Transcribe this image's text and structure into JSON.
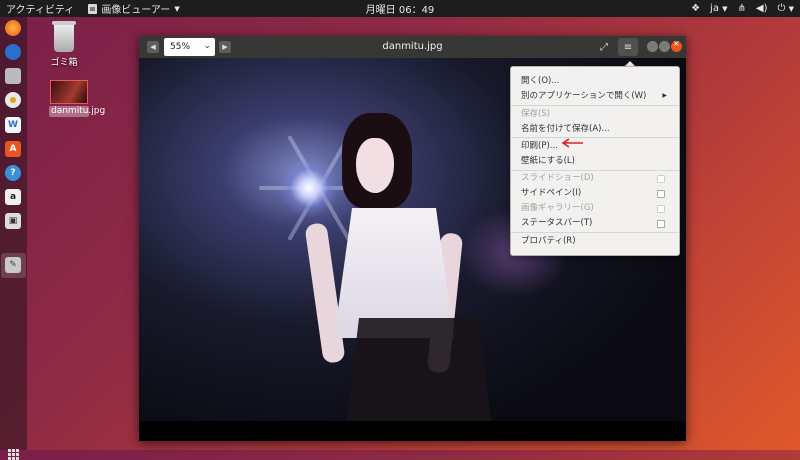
{
  "topbar": {
    "activities": "アクティビティ",
    "app_name": "画像ビューアー",
    "clock": "月曜日 06：49",
    "input_method": "ja"
  },
  "desktop": {
    "trash_label": "ゴミ箱",
    "file_label": "danmitu.jpg"
  },
  "window": {
    "title": "danmitu.jpg",
    "zoom": "55%"
  },
  "menu": {
    "items": [
      {
        "label": "開く(O)..."
      },
      {
        "label": "別のアプリケーションで開く(W)"
      },
      {
        "label": "保存(S)"
      },
      {
        "label": "名前を付けて保存(A)..."
      },
      {
        "label": "印刷(P)..."
      },
      {
        "label": "壁紙にする(L)"
      },
      {
        "label": "スライドショー(D)"
      },
      {
        "label": "サイドペイン(I)"
      },
      {
        "label": "画像ギャラリー(G)"
      },
      {
        "label": "ステータスバー(T)"
      },
      {
        "label": "プロパティ(R)"
      }
    ]
  },
  "colors": {
    "topbar": "#1d1d1d",
    "titlebar": "#373735",
    "menu_bg": "#f2f1f0",
    "accent_close": "#e95420",
    "annotation_arrow": "#e0201e"
  }
}
